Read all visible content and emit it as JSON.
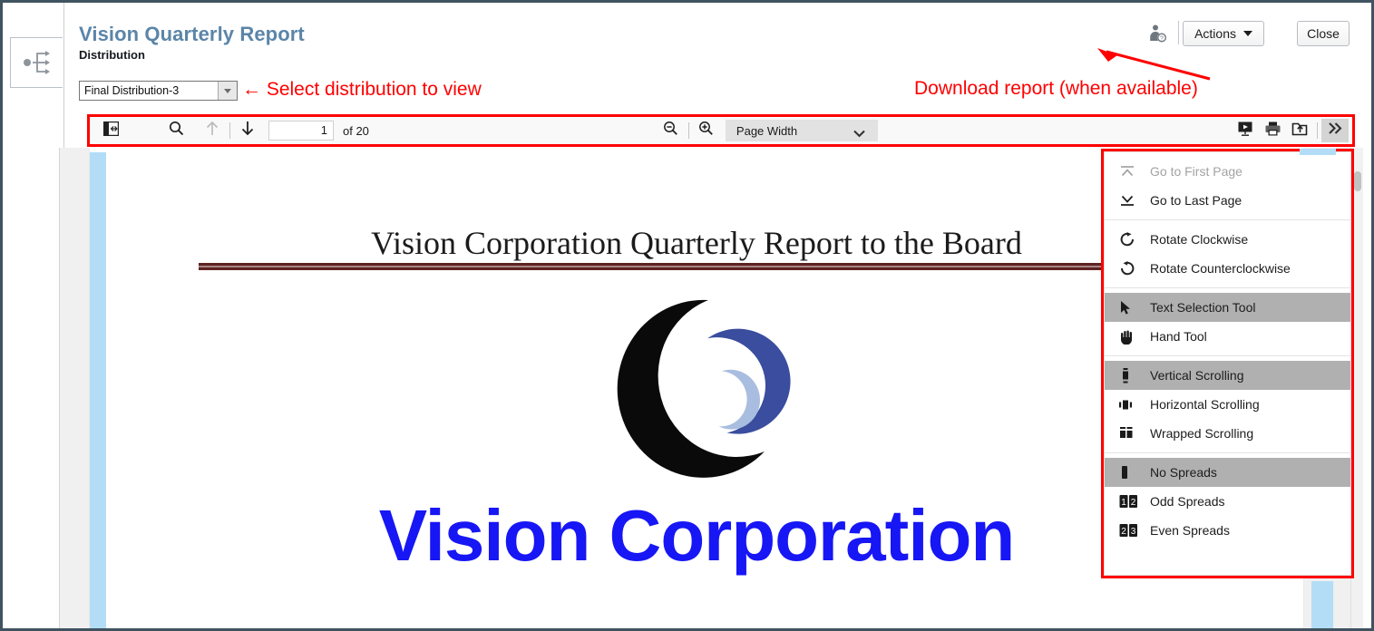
{
  "window": {
    "frame_color": "#3f5360"
  },
  "left_rail": {
    "tab_icon": "workflow-branch-icon"
  },
  "header": {
    "title": "Vision Quarterly Report",
    "subtitle": "Distribution",
    "help_icon": "user-help-icon",
    "actions_label": "Actions",
    "close_label": "Close"
  },
  "distribution": {
    "selected": "Final Distribution-3",
    "options": [
      "Final Distribution-3"
    ]
  },
  "annotations": {
    "select_distribution": "← Select distribution to view",
    "download_report": "Download report (when available)",
    "color": "#fe0000"
  },
  "pdf_toolbar": {
    "sidebar_toggle_icon": "sidebar-toggle-icon",
    "find_icon": "search-icon",
    "previous_page_icon": "arrow-up-icon",
    "next_page_icon": "arrow-down-icon",
    "page_number": "1",
    "page_total": "of 20",
    "zoom_out_icon": "zoom-out-icon",
    "zoom_in_icon": "zoom-in-icon",
    "scale_selected": "Page Width",
    "scale_options": [
      "Page Width"
    ],
    "presentation_icon": "presentation-mode-icon",
    "print_icon": "print-icon",
    "save_icon": "save-download-icon",
    "more_tools_icon": "double-chevron-right-icon"
  },
  "secondary_menu": {
    "groups": [
      {
        "items": [
          {
            "label": "Go to First Page",
            "icon": "go-to-first-page-icon",
            "state": "disabled"
          },
          {
            "label": "Go to Last Page",
            "icon": "go-to-last-page-icon",
            "state": "normal"
          }
        ]
      },
      {
        "items": [
          {
            "label": "Rotate Clockwise",
            "icon": "rotate-clockwise-icon",
            "state": "normal"
          },
          {
            "label": "Rotate Counterclockwise",
            "icon": "rotate-counterclockwise-icon",
            "state": "normal"
          }
        ]
      },
      {
        "items": [
          {
            "label": "Text Selection Tool",
            "icon": "cursor-arrow-icon",
            "state": "selected"
          },
          {
            "label": "Hand Tool",
            "icon": "hand-icon",
            "state": "normal"
          }
        ]
      },
      {
        "items": [
          {
            "label": "Vertical Scrolling",
            "icon": "vertical-scrolling-icon",
            "state": "selected"
          },
          {
            "label": "Horizontal Scrolling",
            "icon": "horizontal-scrolling-icon",
            "state": "normal"
          },
          {
            "label": "Wrapped Scrolling",
            "icon": "wrapped-scrolling-icon",
            "state": "normal"
          }
        ]
      },
      {
        "items": [
          {
            "label": "No Spreads",
            "icon": "no-spreads-icon",
            "state": "selected"
          },
          {
            "label": "Odd Spreads",
            "icon": "odd-spreads-icon",
            "state": "normal"
          },
          {
            "label": "Even Spreads",
            "icon": "even-spreads-icon",
            "state": "normal"
          }
        ]
      }
    ]
  },
  "document": {
    "title": "Vision Corporation Quarterly Report to the Board",
    "rule_color": "#5e2323",
    "logo_icon": "vision-crescent-logo",
    "company_name": "Vision Corporation",
    "company_name_color": "#1716f5"
  }
}
